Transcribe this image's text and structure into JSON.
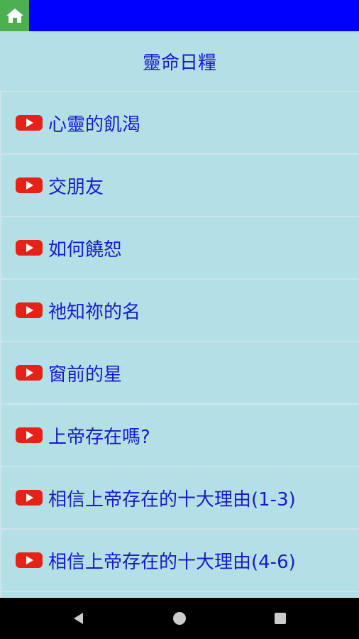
{
  "header": {
    "home_icon": "home-icon",
    "colors": {
      "topbar": "#0000ff",
      "home_button": "#4caf50",
      "background": "#b2e0e6",
      "text": "#1a1acc",
      "video_icon": "#e62117"
    }
  },
  "page": {
    "title": "靈命日糧"
  },
  "list": {
    "items": [
      {
        "icon": "youtube-icon",
        "label": "心靈的飢渴"
      },
      {
        "icon": "youtube-icon",
        "label": "交朋友"
      },
      {
        "icon": "youtube-icon",
        "label": "如何饒恕"
      },
      {
        "icon": "youtube-icon",
        "label": "祂知祢的名"
      },
      {
        "icon": "youtube-icon",
        "label": "窗前的星"
      },
      {
        "icon": "youtube-icon",
        "label": "上帝存在嗎?"
      },
      {
        "icon": "youtube-icon",
        "label": "相信上帝存在的十大理由(1-3)"
      },
      {
        "icon": "youtube-icon",
        "label": "相信上帝存在的十大理由(4-6)"
      }
    ]
  },
  "navbar": {
    "buttons": [
      "back-icon",
      "home-circle-icon",
      "recents-icon"
    ]
  }
}
